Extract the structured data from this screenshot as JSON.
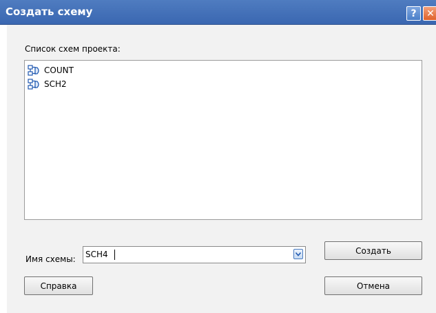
{
  "window": {
    "title": "Создать схему",
    "help_glyph": "?",
    "close_glyph": "✕"
  },
  "list": {
    "label": "Список схем проекта:",
    "items": [
      {
        "label": "COUNT",
        "icon": "schematic-icon"
      },
      {
        "label": "SCH2",
        "icon": "schematic-icon"
      }
    ]
  },
  "name_field": {
    "label": "Имя схемы:",
    "value": "SCH4"
  },
  "buttons": {
    "create": "Создать",
    "help": "Справка",
    "cancel": "Отмена"
  },
  "colors": {
    "titlebar": "#3a67b1",
    "close_button": "#e0612a",
    "client_bg": "#f2f2f2"
  }
}
